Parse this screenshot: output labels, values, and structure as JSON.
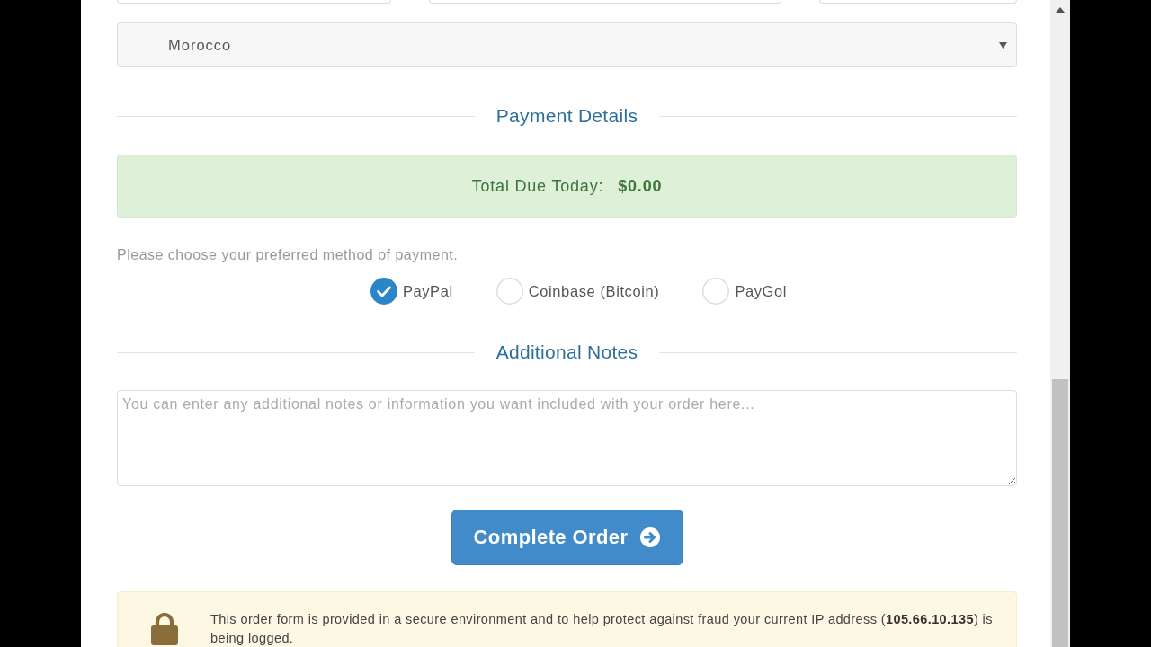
{
  "address_fields": [
    {
      "kind": "text"
    },
    {
      "kind": "text"
    },
    {
      "kind": "text"
    }
  ],
  "country_select": {
    "value": "Morocco"
  },
  "payment_section": {
    "heading": "Payment Details",
    "total": {
      "label": "Total Due Today:",
      "amount": "$0.00"
    },
    "instruction": "Please choose your preferred method of payment.",
    "methods": [
      {
        "label": "PayPal",
        "selected": true
      },
      {
        "label": "Coinbase (Bitcoin)",
        "selected": false
      },
      {
        "label": "PayGol",
        "selected": false
      }
    ]
  },
  "notes_section": {
    "heading": "Additional Notes",
    "placeholder": "You can enter any additional notes or information you want included with your order here..."
  },
  "submit_button": {
    "label": "Complete Order"
  },
  "security_notice": {
    "text": "This order form is provided in a secure environment and to help protect against fraud your current IP address (**105.66.10.135**) is being logged."
  }
}
